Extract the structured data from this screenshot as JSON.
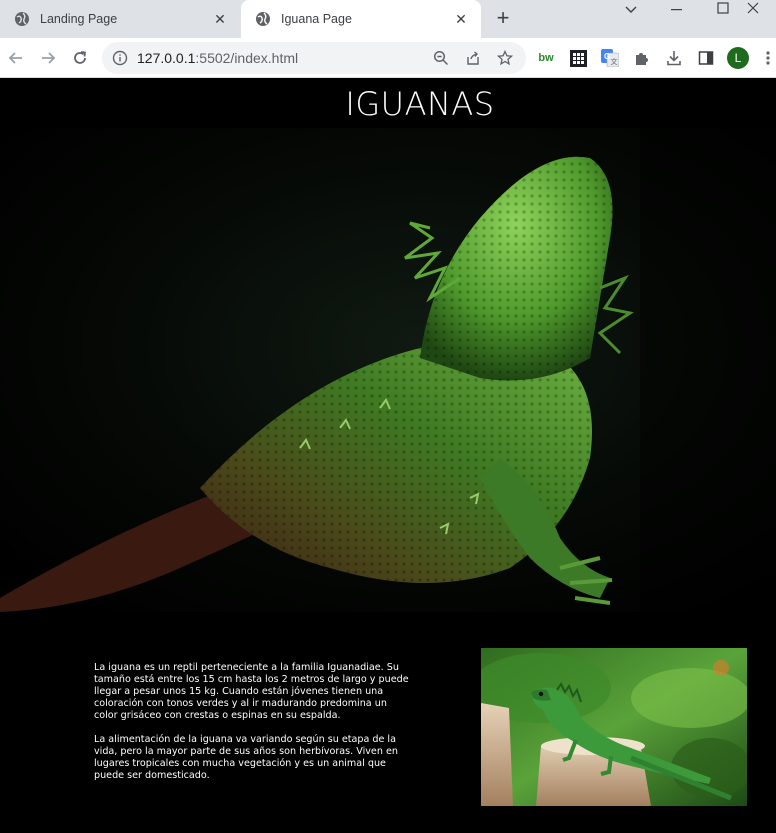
{
  "browser": {
    "tabs": [
      {
        "title": "Landing Page",
        "active": false
      },
      {
        "title": "Iguana Page",
        "active": true
      }
    ],
    "address": {
      "host": "127.0.0.1",
      "rest": ":5502/index.html"
    },
    "profile_initial": "L",
    "extension_label": "bw"
  },
  "page": {
    "title": "IGUANAS",
    "paragraphs": [
      "La iguana es un reptil perteneciente a la familia Iguanadiae. Su tamaño está entre los 15 cm hasta los 2 metros de largo y puede llegar a pesar unos 15 kg. Cuando están jóvenes tienen una coloración con tonos verdes y al ir madurando predomina un color grisáceo con crestas o espinas en su espalda.",
      "La alimentación de la iguana va variando según su etapa de la vida, pero la mayor parte de sus años son herbívoras. Viven en lugares tropicales con mucha vegetación y es un animal que puede ser domesticado."
    ]
  },
  "colors": {
    "page_bg": "#000000",
    "accent_green": "#3a8a2a",
    "profile_green": "#1e6b1e"
  }
}
